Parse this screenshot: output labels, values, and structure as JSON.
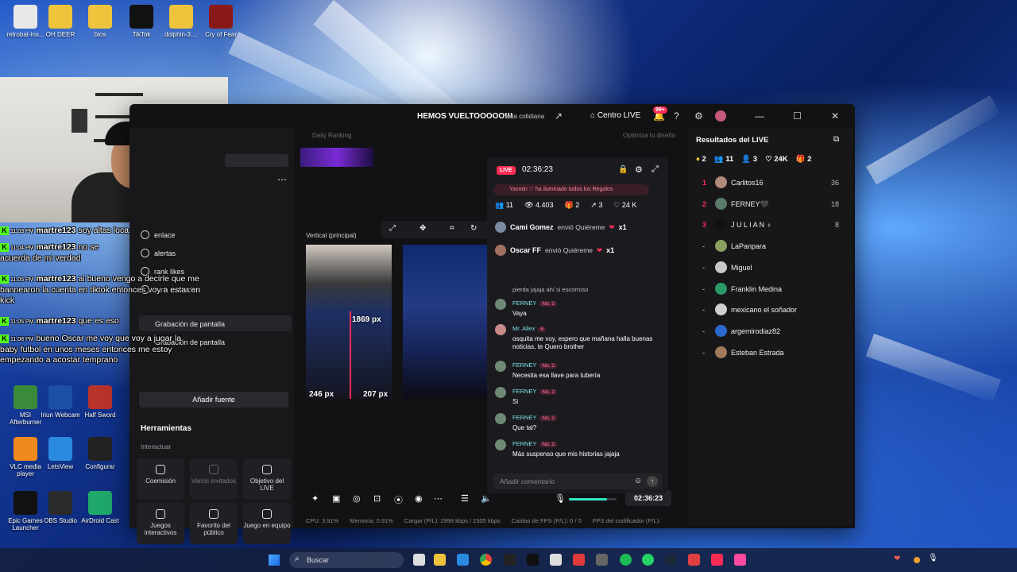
{
  "desktop": {
    "icons": [
      {
        "label": "retrobat-ins...",
        "color": "#e8e8e8"
      },
      {
        "label": "OH DEER",
        "color": "#f0c33c"
      },
      {
        "label": "bios",
        "color": "#f0c33c"
      },
      {
        "label": "TikTok",
        "color": "#111111"
      },
      {
        "label": "dolphin-3....",
        "color": "#f0c33c"
      },
      {
        "label": "Cry of Fear",
        "color": "#8a1a1a"
      },
      {
        "label": "MSI Afterburner",
        "color": "#3a8a3a"
      },
      {
        "label": "Iriun Webcam",
        "color": "#1c4fa8"
      },
      {
        "label": "Half Sword",
        "color": "#b8332a"
      },
      {
        "label": "VLC media player",
        "color": "#f08a1c"
      },
      {
        "label": "LetsView",
        "color": "#2a8ae0"
      },
      {
        "label": "Configurar",
        "color": "#222222"
      },
      {
        "label": "Epic Games Launcher",
        "color": "#111111"
      },
      {
        "label": "OBS Studio",
        "color": "#2a2a2a"
      },
      {
        "label": "AirDroid Cast",
        "color": "#1fa86a"
      }
    ]
  },
  "overlay_chat": [
    {
      "time": "11:03 PM",
      "user": "martre123",
      "text": "soy altas loca"
    },
    {
      "time": "11:04 PM",
      "user": "martre123",
      "text": "no se acuerda de mi verdad"
    },
    {
      "time": "11:05 PM",
      "user": "martre123",
      "text": "ai bueno vengo a decirle que me bannearon la cuenta en tiktok entonces voy a estar en kick"
    },
    {
      "time": "11:05 PM",
      "user": "martre123",
      "text": "que es eso"
    },
    {
      "time": "11:08 PM",
      "user": "",
      "text": "bueno Oscar me voy que voy a jugar la baby futbol en unos meses entonces me estoy empezando a acostar temprano"
    }
  ],
  "window": {
    "title": "HEMOS VUELTOOOOO!!!",
    "category": "Vida cotidiana",
    "centro_live": "Centro LIVE",
    "notif_badge": "99+"
  },
  "left_menu": {
    "items": [
      "enlace",
      "alertas",
      "rank likes",
      "rank monedas"
    ],
    "sources": [
      "Grabación de pantalla",
      "Grabación de pantalla"
    ],
    "add_source": "Añadir fuente",
    "tools_title": "Herramientas",
    "interact_label": "Interactuar",
    "tools": [
      {
        "label": "Coemisión",
        "dim": false
      },
      {
        "label": "Varios invitados",
        "dim": true
      },
      {
        "label": "Objetivo del LIVE",
        "dim": false
      },
      {
        "label": "Juegos interactivos",
        "dim": false
      },
      {
        "label": "Favorito del público",
        "dim": false
      },
      {
        "label": "Juego en equipo",
        "dim": false
      }
    ]
  },
  "center": {
    "daily_ranking": "Daily Ranking",
    "optimize": "Optimiza tu diseño",
    "vertical_title": "Vertical (principal)",
    "px_1": "1869 px",
    "px_2": "246 px",
    "px_3": "207 px",
    "timer": "02:36:23",
    "volume_level": 0.8
  },
  "status_bar": {
    "cpu": "CPU: 3.91%",
    "memory": "Memoria: 0.91%",
    "load": "Cargar (P/L): 2998 kbps / 2305 kbps",
    "fps_drops": "Caídas de FPS (P/L): 0 / 0",
    "encoder_fps": "FPS del codificador (P/L):"
  },
  "chat": {
    "live_label": "LIVE",
    "time": "02:36:23",
    "pinned": "Yasmin ♡ ha iluminado todos los Regalos",
    "stats": {
      "viewers": "11",
      "views": "4.403",
      "gifts": "2",
      "shares": "3",
      "likes": "24 K"
    },
    "gifts": [
      {
        "user": "Cami Gomez",
        "action": "envió Quiéreme",
        "count": "x1"
      },
      {
        "user": "Oscar FF",
        "action": "envió Quiéreme",
        "count": "x1"
      }
    ],
    "partial_line": "pierda jajaja ahí si escorroso",
    "messages": [
      {
        "user": "FERNEY",
        "level": "No. 2",
        "text": "Vaya"
      },
      {
        "user": "Mr. Allex",
        "level": "6",
        "text": "osquita me voy, espero que mañana halla buenas noticias, te Quero brother"
      },
      {
        "user": "FERNEY",
        "level": "No. 2",
        "text": "Necesita esa llave para tubería"
      },
      {
        "user": "FERNEY",
        "level": "No. 2",
        "text": "Si"
      },
      {
        "user": "FERNEY",
        "level": "No. 2",
        "text": "Que tal?"
      },
      {
        "user": "FERNEY",
        "level": "No. 2",
        "text": "Más suspenso que mis historias jajaja"
      }
    ],
    "input_placeholder": "Añadir comentario"
  },
  "results": {
    "title": "Resultados del LIVE",
    "stats": [
      "2",
      "11",
      "3",
      "24K",
      "2"
    ],
    "ranking": [
      {
        "rank": "1",
        "name": "Carlitos16",
        "score": "36",
        "color": "#b08a7a"
      },
      {
        "rank": "2",
        "name": "FERNEY🖤",
        "score": "18",
        "color": "#5a7a6a"
      },
      {
        "rank": "3",
        "name": "J U L I A N ♁",
        "score": "8",
        "color": "#111111"
      },
      {
        "rank": "-",
        "name": "LaPanpara",
        "score": "",
        "color": "#8aa060"
      },
      {
        "rank": "-",
        "name": "Miguel",
        "score": "",
        "color": "#c8c8c8"
      },
      {
        "rank": "-",
        "name": "Franklin Medina",
        "score": "",
        "color": "#2a9a6a"
      },
      {
        "rank": "-",
        "name": "mexicano el soñador",
        "score": "",
        "color": "#d0d0d0"
      },
      {
        "rank": "-",
        "name": "argemirodiaz82",
        "score": "",
        "color": "#2a6ad0"
      },
      {
        "rank": "-",
        "name": "Esteban Estrada",
        "score": "",
        "color": "#a07a5a"
      }
    ]
  },
  "taskbar": {
    "search_placeholder": "Buscar"
  }
}
